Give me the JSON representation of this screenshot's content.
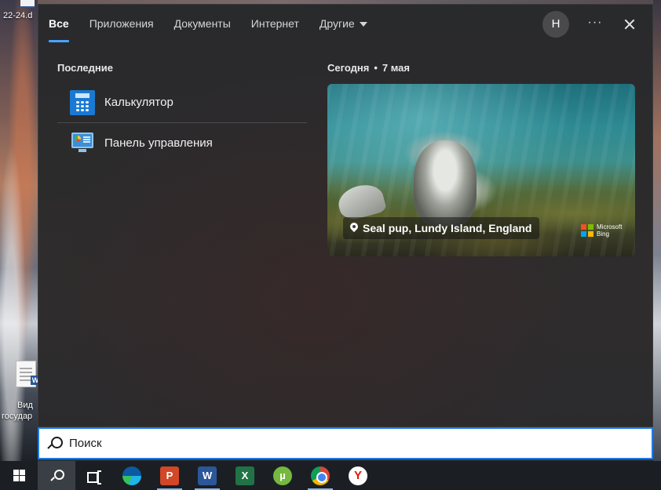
{
  "desktop": {
    "top_left_label": "22-24.d",
    "doc_label_line1": "Вид",
    "doc_label_line2": "государ"
  },
  "tabs": [
    {
      "label": "Все",
      "active": true
    },
    {
      "label": "Приложения",
      "active": false
    },
    {
      "label": "Документы",
      "active": false
    },
    {
      "label": "Интернет",
      "active": false
    },
    {
      "label": "Другие",
      "active": false,
      "has_dropdown": true
    }
  ],
  "header": {
    "avatar_initial": "Н",
    "more_label": "···"
  },
  "recent": {
    "title": "Последние",
    "items": [
      {
        "label": "Калькулятор",
        "icon": "calculator-icon"
      },
      {
        "label": "Панель управления",
        "icon": "control-panel-icon"
      }
    ]
  },
  "today": {
    "label": "Сегодня",
    "separator": "•",
    "date": "7 мая",
    "card": {
      "caption": "Seal pup, Lundy Island, England",
      "brand_line1": "Microsoft",
      "brand_line2": "Bing"
    }
  },
  "search": {
    "placeholder": "Поиск",
    "value": ""
  },
  "taskbar": {
    "items": [
      {
        "name": "start-button",
        "icon": "windows-logo-icon"
      },
      {
        "name": "search-button",
        "icon": "search-icon",
        "active": true
      },
      {
        "name": "task-view-button",
        "icon": "task-view-icon"
      },
      {
        "name": "edge-button",
        "icon": "edge-icon"
      },
      {
        "name": "powerpoint-button",
        "icon": "powerpoint-icon",
        "glyph": "P"
      },
      {
        "name": "word-button",
        "icon": "word-icon",
        "glyph": "W"
      },
      {
        "name": "excel-button",
        "icon": "excel-icon",
        "glyph": "X"
      },
      {
        "name": "utorrent-button",
        "icon": "utorrent-icon",
        "glyph": "µ"
      },
      {
        "name": "chrome-button",
        "icon": "chrome-icon"
      },
      {
        "name": "yandex-button",
        "icon": "yandex-browser-icon",
        "glyph": "Y"
      }
    ]
  },
  "colors": {
    "accent": "#4aa3ff",
    "panel_bg": "#2b2b2d",
    "search_border": "#1f7be0",
    "taskbar_bg": "#1b1f24"
  }
}
